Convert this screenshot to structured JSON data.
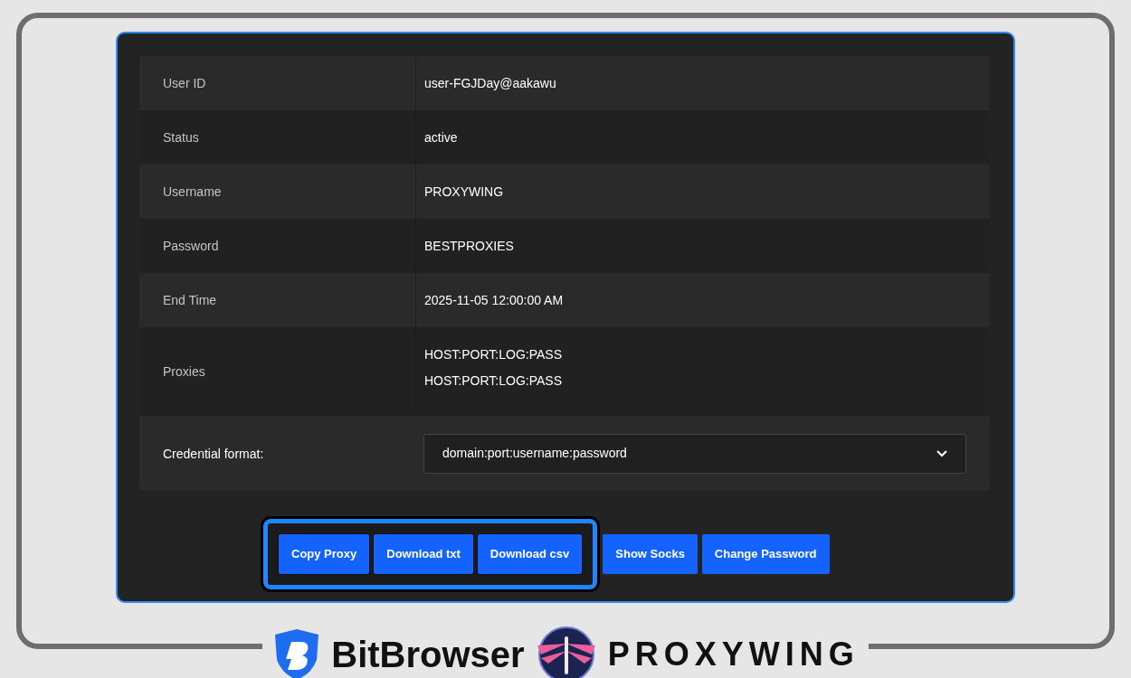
{
  "details": [
    {
      "label": "User ID",
      "values": [
        "user-FGJDay@aakawu"
      ]
    },
    {
      "label": "Status",
      "values": [
        "active"
      ]
    },
    {
      "label": "Username",
      "values": [
        "PROXYWING"
      ]
    },
    {
      "label": "Password",
      "values": [
        "BESTPROXIES"
      ]
    },
    {
      "label": "End Time",
      "values": [
        "2025-11-05 12:00:00 AM"
      ]
    },
    {
      "label": "Proxies",
      "values": [
        "HOST:PORT:LOG:PASS",
        "HOST:PORT:LOG:PASS"
      ]
    }
  ],
  "credential_format": {
    "label": "Credential format:",
    "value": "domain:port:username:password"
  },
  "buttons": [
    {
      "label": "Copy Proxy",
      "highlighted": true
    },
    {
      "label": "Download txt",
      "highlighted": true
    },
    {
      "label": "Download csv",
      "highlighted": true
    },
    {
      "label": "Show Socks",
      "highlighted": false
    },
    {
      "label": "Change Password",
      "highlighted": false
    }
  ],
  "footer": {
    "brand_left": "BitBrowser",
    "brand_right": "PROXYWING"
  }
}
